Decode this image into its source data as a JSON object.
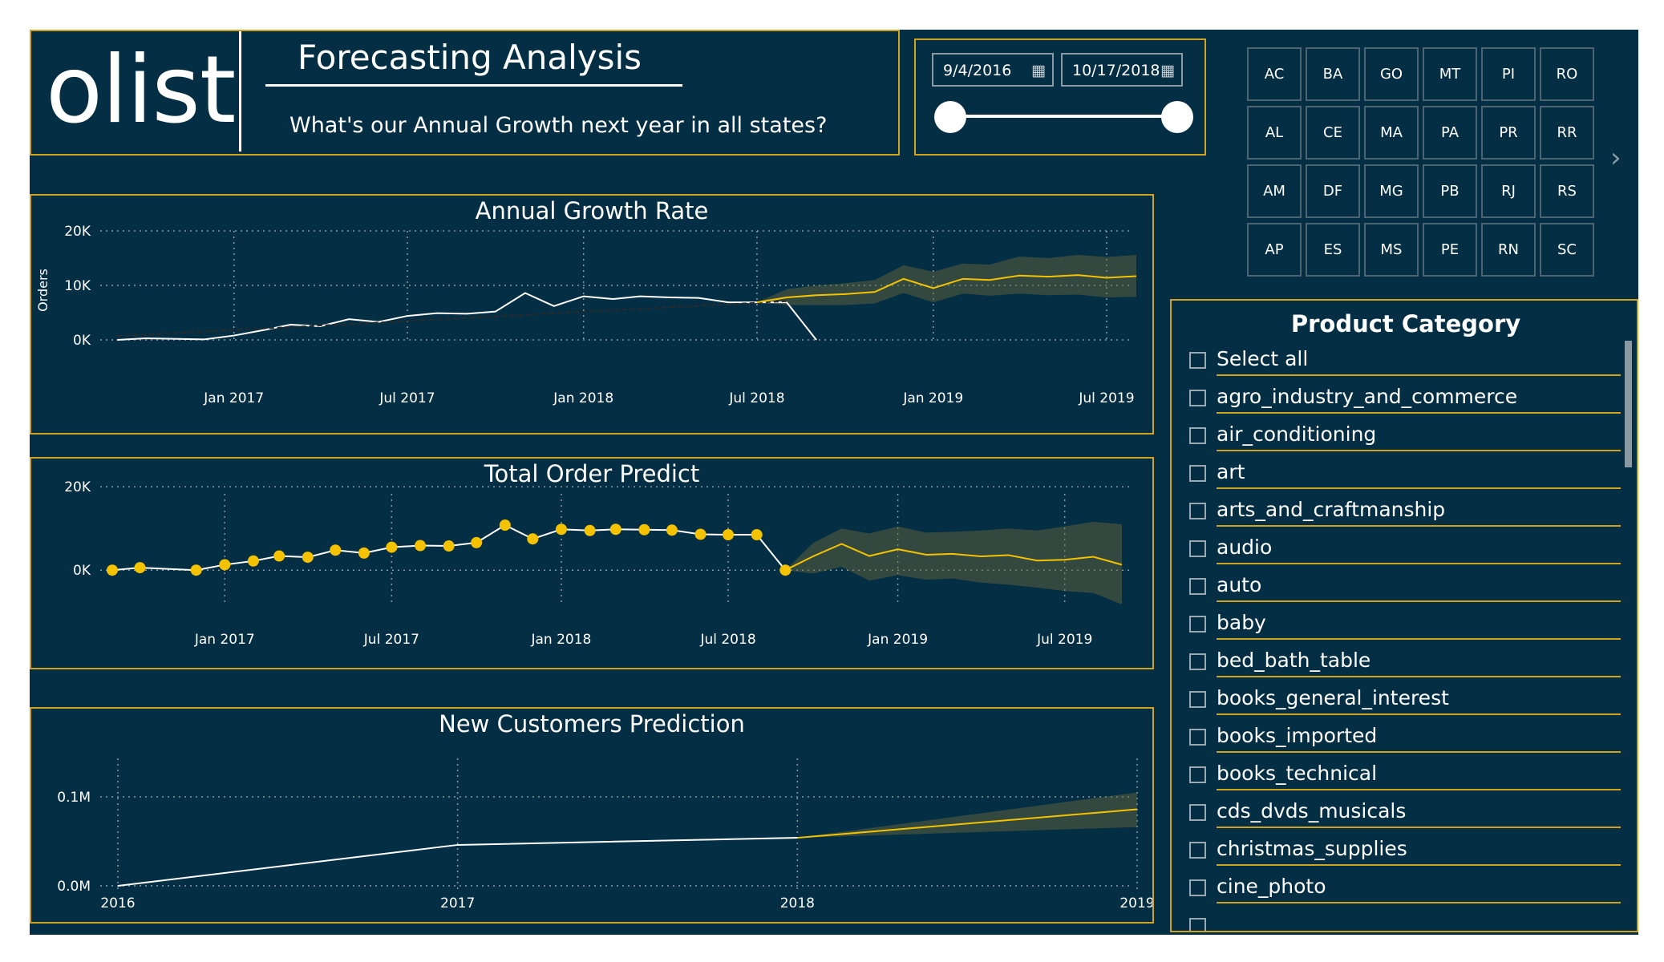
{
  "header": {
    "logo": "olist",
    "title": "Forecasting Analysis",
    "subtitle": "What's our Annual Growth next year in all states?"
  },
  "date_filter": {
    "start": "9/4/2016",
    "end": "10/17/2018",
    "calendar_icon": "calendar-icon"
  },
  "states": [
    [
      "AC",
      "BA",
      "GO",
      "MT",
      "PI",
      "RO"
    ],
    [
      "AL",
      "CE",
      "MA",
      "PA",
      "PR",
      "RR"
    ],
    [
      "AM",
      "DF",
      "MG",
      "PB",
      "RJ",
      "RS"
    ],
    [
      "AP",
      "ES",
      "MS",
      "PE",
      "RN",
      "SC"
    ]
  ],
  "states_next_glyph": "›",
  "category_filter": {
    "title": "Product Category",
    "items": [
      "Select all",
      "agro_industry_and_commerce",
      "air_conditioning",
      "art",
      "arts_and_craftmanship",
      "audio",
      "auto",
      "baby",
      "bed_bath_table",
      "books_general_interest",
      "books_imported",
      "books_technical",
      "cds_dvds_musicals",
      "christmas_supplies",
      "cine_photo"
    ]
  },
  "colors": {
    "background": "#032e44",
    "accent": "#f5c200",
    "border": "#d2a21e",
    "actual_line": "#ffffff"
  },
  "chart_data": [
    {
      "type": "line",
      "title": "Annual Growth Rate",
      "ylabel": "Orders",
      "xlabel": "",
      "ylim": [
        0,
        20000
      ],
      "y_ticks": [
        "0K",
        "10K",
        "20K"
      ],
      "x_ticks": [
        "Jan 2017",
        "Jul 2017",
        "Jan 2018",
        "Jul 2018",
        "Jan 2019",
        "Jul 2019"
      ],
      "x_tick_dates": [
        "2017-01-01",
        "2017-07-01",
        "2018-01-01",
        "2018-07-01",
        "2019-01-01",
        "2019-07-01"
      ],
      "x_range": [
        "2016-09-01",
        "2019-08-01"
      ],
      "grid": true,
      "series": [
        {
          "role": "actual",
          "color": "#ffffff",
          "x": [
            "2016-09-01",
            "2016-10-01",
            "2016-12-01",
            "2017-01-01",
            "2017-02-01",
            "2017-03-01",
            "2017-04-01",
            "2017-05-01",
            "2017-06-01",
            "2017-07-01",
            "2017-08-01",
            "2017-09-01",
            "2017-10-01",
            "2017-11-01",
            "2017-12-01",
            "2018-01-01",
            "2018-02-01",
            "2018-03-01",
            "2018-04-01",
            "2018-05-01",
            "2018-06-01",
            "2018-07-01",
            "2018-08-01",
            "2018-09-01"
          ],
          "y": [
            0,
            300,
            100,
            800,
            1800,
            2800,
            2500,
            3800,
            3300,
            4400,
            4900,
            4800,
            5200,
            8600,
            6200,
            8000,
            7500,
            8000,
            7800,
            7700,
            6900,
            6900,
            6900,
            0
          ]
        },
        {
          "role": "trend",
          "color": "#2a2a2a",
          "x": [
            "2016-09-01",
            "2018-08-01"
          ],
          "y": [
            700,
            7100
          ]
        },
        {
          "role": "forecast",
          "color": "#f5c200",
          "x": [
            "2018-07-01",
            "2018-08-01",
            "2018-09-01",
            "2018-10-01",
            "2018-11-01",
            "2018-12-01",
            "2019-01-01",
            "2019-02-01",
            "2019-03-01",
            "2019-04-01",
            "2019-05-01",
            "2019-06-01",
            "2019-07-01",
            "2019-08-01"
          ],
          "y": [
            6900,
            7800,
            8200,
            8400,
            8800,
            11200,
            9500,
            11200,
            11000,
            11800,
            11600,
            11900,
            11400,
            11700
          ],
          "upper": [
            6900,
            9300,
            10000,
            10400,
            11000,
            13700,
            12500,
            14000,
            13800,
            15300,
            15000,
            15600,
            15200,
            15600
          ],
          "lower": [
            6900,
            6400,
            6400,
            6400,
            6700,
            8600,
            6900,
            8500,
            8100,
            8500,
            8200,
            8300,
            7800,
            7900
          ]
        }
      ]
    },
    {
      "type": "line",
      "title": "Total Order Predict",
      "ylabel": "",
      "xlabel": "",
      "ylim": [
        -4000,
        22000
      ],
      "y_ticks": [
        "0K",
        "20K"
      ],
      "x_ticks": [
        "Jan 2017",
        "Jul 2017",
        "Jan 2018",
        "Jul 2018",
        "Jan 2019",
        "Jul 2019"
      ],
      "x_tick_dates": [
        "2017-01-01",
        "2017-07-01",
        "2018-01-01",
        "2018-07-01",
        "2019-01-01",
        "2019-07-01"
      ],
      "x_range": [
        "2016-09-01",
        "2019-09-01"
      ],
      "grid": true,
      "series": [
        {
          "role": "actual",
          "color": "#ffffff",
          "marker_color": "#f5c200",
          "x": [
            "2016-09-01",
            "2016-10-01",
            "2016-12-01",
            "2017-01-01",
            "2017-02-01",
            "2017-03-01",
            "2017-04-01",
            "2017-05-01",
            "2017-06-01",
            "2017-07-01",
            "2017-08-01",
            "2017-09-01",
            "2017-10-01",
            "2017-11-01",
            "2017-12-01",
            "2018-01-01",
            "2018-02-01",
            "2018-03-01",
            "2018-04-01",
            "2018-05-01",
            "2018-06-01",
            "2018-07-01",
            "2018-08-01",
            "2018-09-01"
          ],
          "y": [
            0,
            600,
            0,
            1300,
            2200,
            3400,
            3100,
            4800,
            4100,
            5500,
            5900,
            5800,
            6600,
            10800,
            7500,
            9800,
            9500,
            9800,
            9700,
            9600,
            8600,
            8500,
            8500,
            0
          ]
        },
        {
          "role": "forecast",
          "color": "#f5c200",
          "x": [
            "2018-09-01",
            "2018-10-01",
            "2018-11-01",
            "2018-12-01",
            "2019-01-01",
            "2019-02-01",
            "2019-03-01",
            "2019-04-01",
            "2019-05-01",
            "2019-06-01",
            "2019-07-01",
            "2019-08-01",
            "2019-09-01"
          ],
          "y": [
            0,
            3300,
            6300,
            3400,
            5000,
            3700,
            3900,
            3300,
            3600,
            2300,
            2500,
            3200,
            1300
          ],
          "upper": [
            0,
            6500,
            10000,
            8800,
            10500,
            9000,
            9200,
            9500,
            10000,
            9500,
            10500,
            11600,
            11000
          ],
          "lower": [
            0,
            -800,
            800,
            -2500,
            -1200,
            -2300,
            -2000,
            -3000,
            -3500,
            -4200,
            -5000,
            -5500,
            -8200
          ]
        }
      ]
    },
    {
      "type": "line",
      "title": "New Customers Prediction",
      "ylabel": "",
      "xlabel": "",
      "ylim": [
        0,
        120000
      ],
      "y_ticks": [
        "0.0M",
        "0.1M"
      ],
      "x_ticks": [
        "2016",
        "2017",
        "2018",
        "2019"
      ],
      "x_range": [
        2016,
        2019
      ],
      "grid": true,
      "series": [
        {
          "role": "actual",
          "color": "#ffffff",
          "x": [
            2016,
            2017,
            2018
          ],
          "y": [
            0,
            46000,
            54000
          ]
        },
        {
          "role": "forecast",
          "color": "#f5c200",
          "x": [
            2018,
            2019
          ],
          "y": [
            54000,
            86000
          ],
          "upper": [
            54000,
            105000
          ],
          "lower": [
            54000,
            66000
          ]
        }
      ]
    }
  ]
}
